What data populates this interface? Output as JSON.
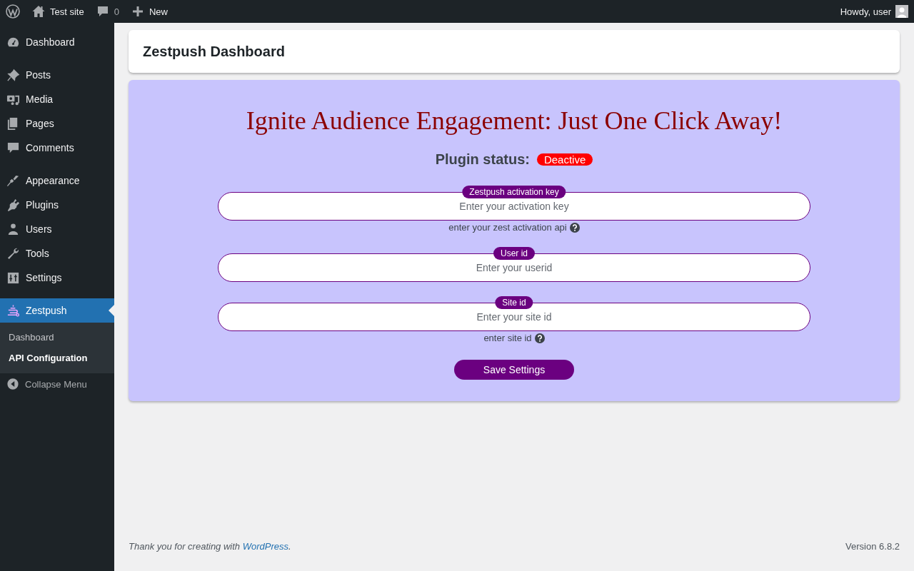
{
  "admin_bar": {
    "site": "Test site",
    "comments_count": "0",
    "new": "New",
    "greeting": "Howdy, user"
  },
  "sidebar": {
    "groups": [
      [
        {
          "label": "Dashboard",
          "selected": false
        }
      ],
      [
        {
          "label": "Posts",
          "selected": false
        },
        {
          "label": "Media",
          "selected": false
        },
        {
          "label": "Pages",
          "selected": false
        },
        {
          "label": "Comments",
          "selected": false
        }
      ],
      [
        {
          "label": "Appearance",
          "selected": false
        },
        {
          "label": "Plugins",
          "selected": false
        },
        {
          "label": "Users",
          "selected": false
        },
        {
          "label": "Tools",
          "selected": false
        },
        {
          "label": "Settings",
          "selected": false
        }
      ],
      [
        {
          "label": "Zestpush",
          "selected": true,
          "children": [
            {
              "label": "Dashboard",
              "selected": false
            },
            {
              "label": "API Configuration",
              "selected": true
            }
          ]
        }
      ]
    ],
    "collapse": "Collapse Menu"
  },
  "page_title": "Zestpush Dashboard",
  "panel": {
    "heading": "Ignite Audience Engagement: Just One Click Away!",
    "status_label": "Plugin status:",
    "status": "Deactive",
    "fields": [
      {
        "label": "Zestpush activation key",
        "placeholder": "Enter your activation key",
        "help": "enter your zest activation api"
      },
      {
        "label": "User id",
        "placeholder": "Enter your userid"
      },
      {
        "label": "Site id",
        "placeholder": "Enter your site id",
        "help": "enter site id"
      }
    ],
    "button": "Save Settings"
  },
  "footer": {
    "text_before": "Thank you for creating with ",
    "link": "WordPress",
    "text_after": ".",
    "version": "Version 6.8.2"
  }
}
